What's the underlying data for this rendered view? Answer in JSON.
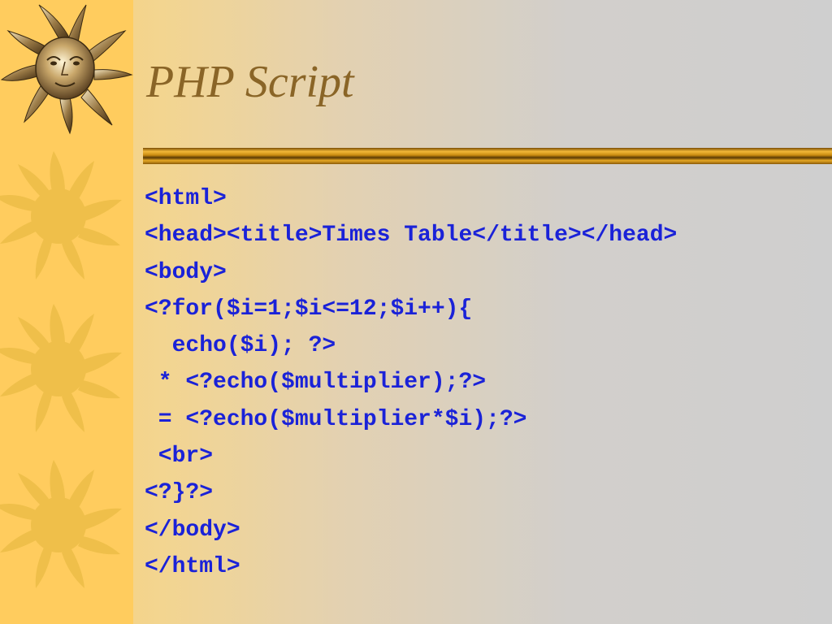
{
  "slide": {
    "title": "PHP Script",
    "code_lines": [
      "<html>",
      "<head><title>Times Table</title></head>",
      "<body>",
      "<?for($i=1;$i<=12;$i++){",
      "  echo($i); ?>",
      " * <?echo($multiplier);?>",
      " = <?echo($multiplier*$i);?>",
      " <br>",
      "<?}?>",
      "</body>",
      "</html>"
    ]
  },
  "colors": {
    "title": "#8a6527",
    "code": "#1a22d8",
    "strip": "#ffcc5e",
    "sun": "#efbf4a",
    "bar_gold": "#d99a16",
    "bar_dark": "#5a3a05"
  },
  "decorations": {
    "icons": [
      "sun-face-icon",
      "sun-icon",
      "sun-icon",
      "sun-icon"
    ]
  }
}
